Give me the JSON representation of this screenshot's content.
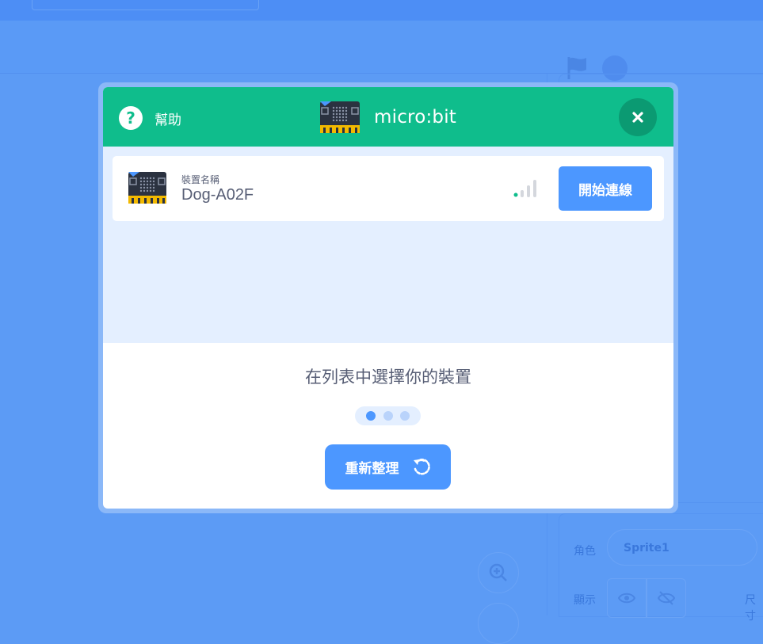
{
  "modal": {
    "title": "micro:bit",
    "help_label": "幫助",
    "device": {
      "caption": "裝置名稱",
      "name": "Dog-A02F",
      "connect_label": "開始連線"
    },
    "instructions": "在列表中選擇你的裝置",
    "refresh_label": "重新整理",
    "step_dots": 3,
    "active_step": 1
  },
  "background": {
    "sprite_label": "角色",
    "sprite_name": "Sprite1",
    "show_label": "顯示",
    "size_label": "尺寸"
  },
  "colors": {
    "header": "#0fbd8c",
    "primary": "#4c97ff",
    "text": "#575e75",
    "overlay": "#5c9bf5"
  }
}
